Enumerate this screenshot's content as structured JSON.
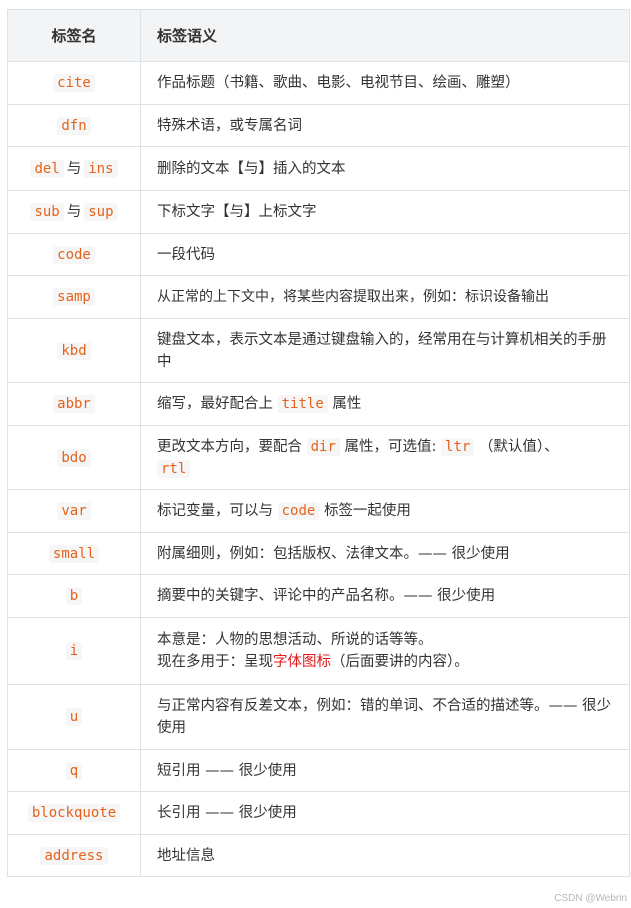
{
  "header": {
    "col1": "标签名",
    "col2": "标签语义"
  },
  "rows": [
    {
      "tag": "cite",
      "desc": "作品标题（书籍、歌曲、电影、电视节目、绘画、雕塑）"
    },
    {
      "tag": "dfn",
      "desc": "特殊术语，或专属名词"
    },
    {
      "tag": "del",
      "joiner": "与",
      "tag2": "ins",
      "desc": "删除的文本【与】插入的文本"
    },
    {
      "tag": "sub",
      "joiner": "与",
      "tag2": "sup",
      "desc": "下标文字【与】上标文字"
    },
    {
      "tag": "code",
      "desc": "一段代码"
    },
    {
      "tag": "samp",
      "desc": "从正常的上下文中，将某些内容提取出来，例如：标识设备输出"
    },
    {
      "tag": "kbd",
      "desc": "键盘文本，表示文本是通过键盘输入的，经常用在与计算机相关的手册中"
    },
    {
      "tag": "abbr",
      "desc_a": "缩写，最好配合上",
      "code": "title",
      "desc_b": "属性"
    },
    {
      "tag": "bdo",
      "desc_a": "更改文本方向，要配合",
      "code": "dir",
      "desc_b": "属性，可选值:",
      "code2": "ltr",
      "desc_c": "（默认值）、",
      "code3": "rtl"
    },
    {
      "tag": "var",
      "desc_a": "标记变量，可以与",
      "code": "code",
      "desc_b": "标签一起使用"
    },
    {
      "tag": "small",
      "desc": "附属细则，例如：包括版权、法律文本。—— 很少使用"
    },
    {
      "tag": "b",
      "desc": "摘要中的关键字、评论中的产品名称。—— 很少使用"
    },
    {
      "tag": "i",
      "line1": "本意是：人物的思想活动、所说的话等等。",
      "line2_a": "现在多用于：呈现",
      "line2_red": "字体图标",
      "line2_b": "（后面要讲的内容）。"
    },
    {
      "tag": "u",
      "desc": "与正常内容有反差文本，例如：错的单词、不合适的描述等。—— 很少使用"
    },
    {
      "tag": "q",
      "desc": "短引用 —— 很少使用"
    },
    {
      "tag": "blockquote",
      "desc": "长引用 —— 很少使用"
    },
    {
      "tag": "address",
      "desc": "地址信息"
    }
  ],
  "watermark": "CSDN @Webrin",
  "colors": {
    "code_text": "#e5621a",
    "code_bg": "#f6f6f6",
    "header_bg": "#f3f4f5",
    "highlight": "#e31b1b"
  }
}
